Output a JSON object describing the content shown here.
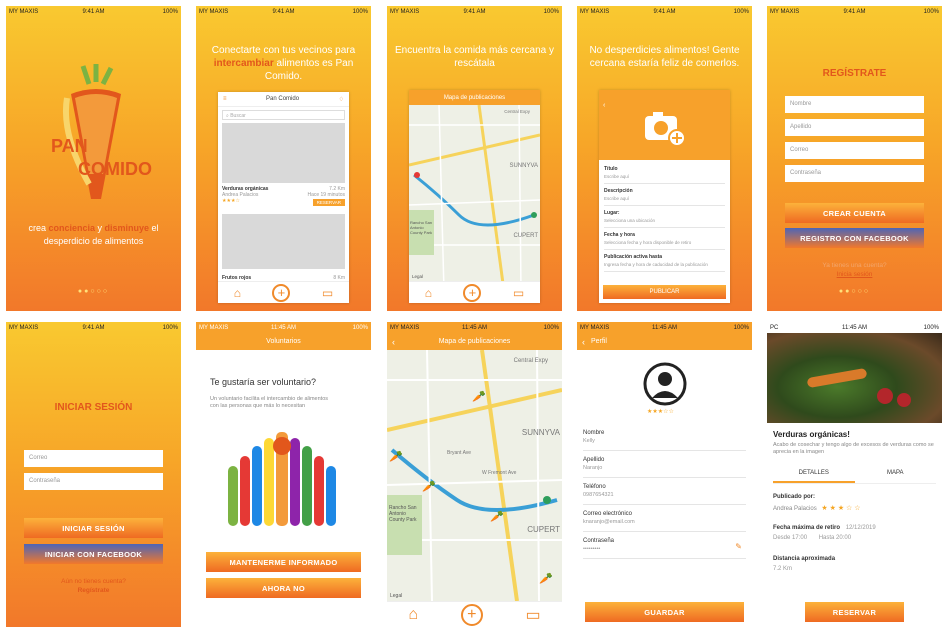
{
  "status": {
    "carrier": "MY MAXIS",
    "carrier_pc": "PC",
    "time_a": "9:41 AM",
    "time_b": "11:45 AM",
    "battery": "100%"
  },
  "splash": {
    "logo_line1": "PAN",
    "logo_line2": "COMIDO",
    "tagline_part1": "crea ",
    "tagline_bold1": "conciencia",
    "tagline_part2": " y ",
    "tagline_bold2": "disminuye",
    "tagline_part3": " el desperdicio de alimentos"
  },
  "onboard1": {
    "text1": "Conectarte con tus vecinos para ",
    "bold": "intercambiar",
    "text2": " alimentos es Pan Comido.",
    "app_title": "Pan Comido",
    "search_placeholder": "Buscar",
    "item1_title": "Verduras orgánicas",
    "item1_author": "Andrea Palacios",
    "item1_distance": "7.2 Km",
    "item1_time": "Hace 19 minutos",
    "item1_button": "RESERVAR",
    "item2_title": "Frutos rojos",
    "item2_distance": "8 Km"
  },
  "onboard2": {
    "text": "Encuentra la comida más cercana y rescátala",
    "map_title": "Mapa de publicaciones",
    "map_label_1": "SUNNYVA",
    "map_label_2": "CUPERT",
    "map_label_3": "Rancho San Antonio County Park",
    "map_label_4": "Central Expy",
    "map_legal": "Legal"
  },
  "onboard3": {
    "text": "No desperdicies alimentos! Gente cercana estaría feliz de comerlos.",
    "fields": [
      {
        "label": "Título",
        "value": "Escribe aquí"
      },
      {
        "label": "Descripción",
        "value": "Escribe aquí"
      },
      {
        "label": "Lugar:",
        "value": "Selecciona una ubicación"
      },
      {
        "label": "Fecha y hora",
        "value": "Selecciona fecha y hora disponible de retiro"
      },
      {
        "label": "Publicación activa hasta",
        "value": "Ingresa fecha y hora de caducidad de la publicación"
      }
    ],
    "publish": "PUBLICAR"
  },
  "register": {
    "title": "REGÍSTRATE",
    "name": "Nombre",
    "lastname": "Apellido",
    "email": "Correo",
    "password": "Contraseña",
    "create": "CREAR CUENTA",
    "facebook": "REGISTRO CON FACEBOOK",
    "have_account": "Ya tienes una cuenta?",
    "login": "Inicia sesión"
  },
  "login": {
    "title": "INICIAR SESIÓN",
    "email": "Correo",
    "password": "Contraseña",
    "submit": "INICIAR SESIÓN",
    "facebook": "INICIAR CON FACEBOOK",
    "no_account": "Aún no tienes cuenta?",
    "register": "Regístrate"
  },
  "volunteer": {
    "header": "Voluntarios",
    "question": "Te gustaría ser voluntario?",
    "desc": "Un voluntario facilita el intercambio de alimentos con las personas que más lo necesitan",
    "btn_inform": "MANTENERME INFORMADO",
    "btn_no": "AHORA NO"
  },
  "mapscreen": {
    "title": "Mapa de publicaciones",
    "label_1": "SUNNYVA",
    "label_2": "CUPERT",
    "label_3": "Rancho San Antonio County Park",
    "label_4": "Central Expy",
    "label_5": "W Fremont Ave",
    "label_6": "Bryant Ave",
    "legal": "Legal"
  },
  "profile": {
    "title": "Perfil",
    "fields": [
      {
        "label": "Nombre",
        "value": "Kelly"
      },
      {
        "label": "Apellido",
        "value": "Naranjo"
      },
      {
        "label": "Teléfono",
        "value": "0987654321"
      },
      {
        "label": "Correo electrónico",
        "value": "knaranjo@email.com"
      },
      {
        "label": "Contraseña",
        "value": "•••••••••"
      }
    ],
    "save": "GUARDAR"
  },
  "detail": {
    "title": "Verduras orgánicas!",
    "desc": "Acabo de cosechar y tengo algo de excesos de verduras como se aprecia en la imagen",
    "tab_details": "DETALLES",
    "tab_map": "MAPA",
    "published_by": "Publicado por:",
    "author": "Andrea Palacios",
    "max_date_label": "Fecha máxima de retiro",
    "max_date": "12/12/2019",
    "from": "Desde 17:00",
    "until": "Hasta 20:00",
    "distance_label": "Distancia aproximada",
    "distance": "7.2 Km",
    "reserve": "RESERVAR"
  },
  "colors": {
    "orange": "#f7a12b",
    "dark_orange": "#e2571c",
    "facebook": "#4d64b6"
  }
}
